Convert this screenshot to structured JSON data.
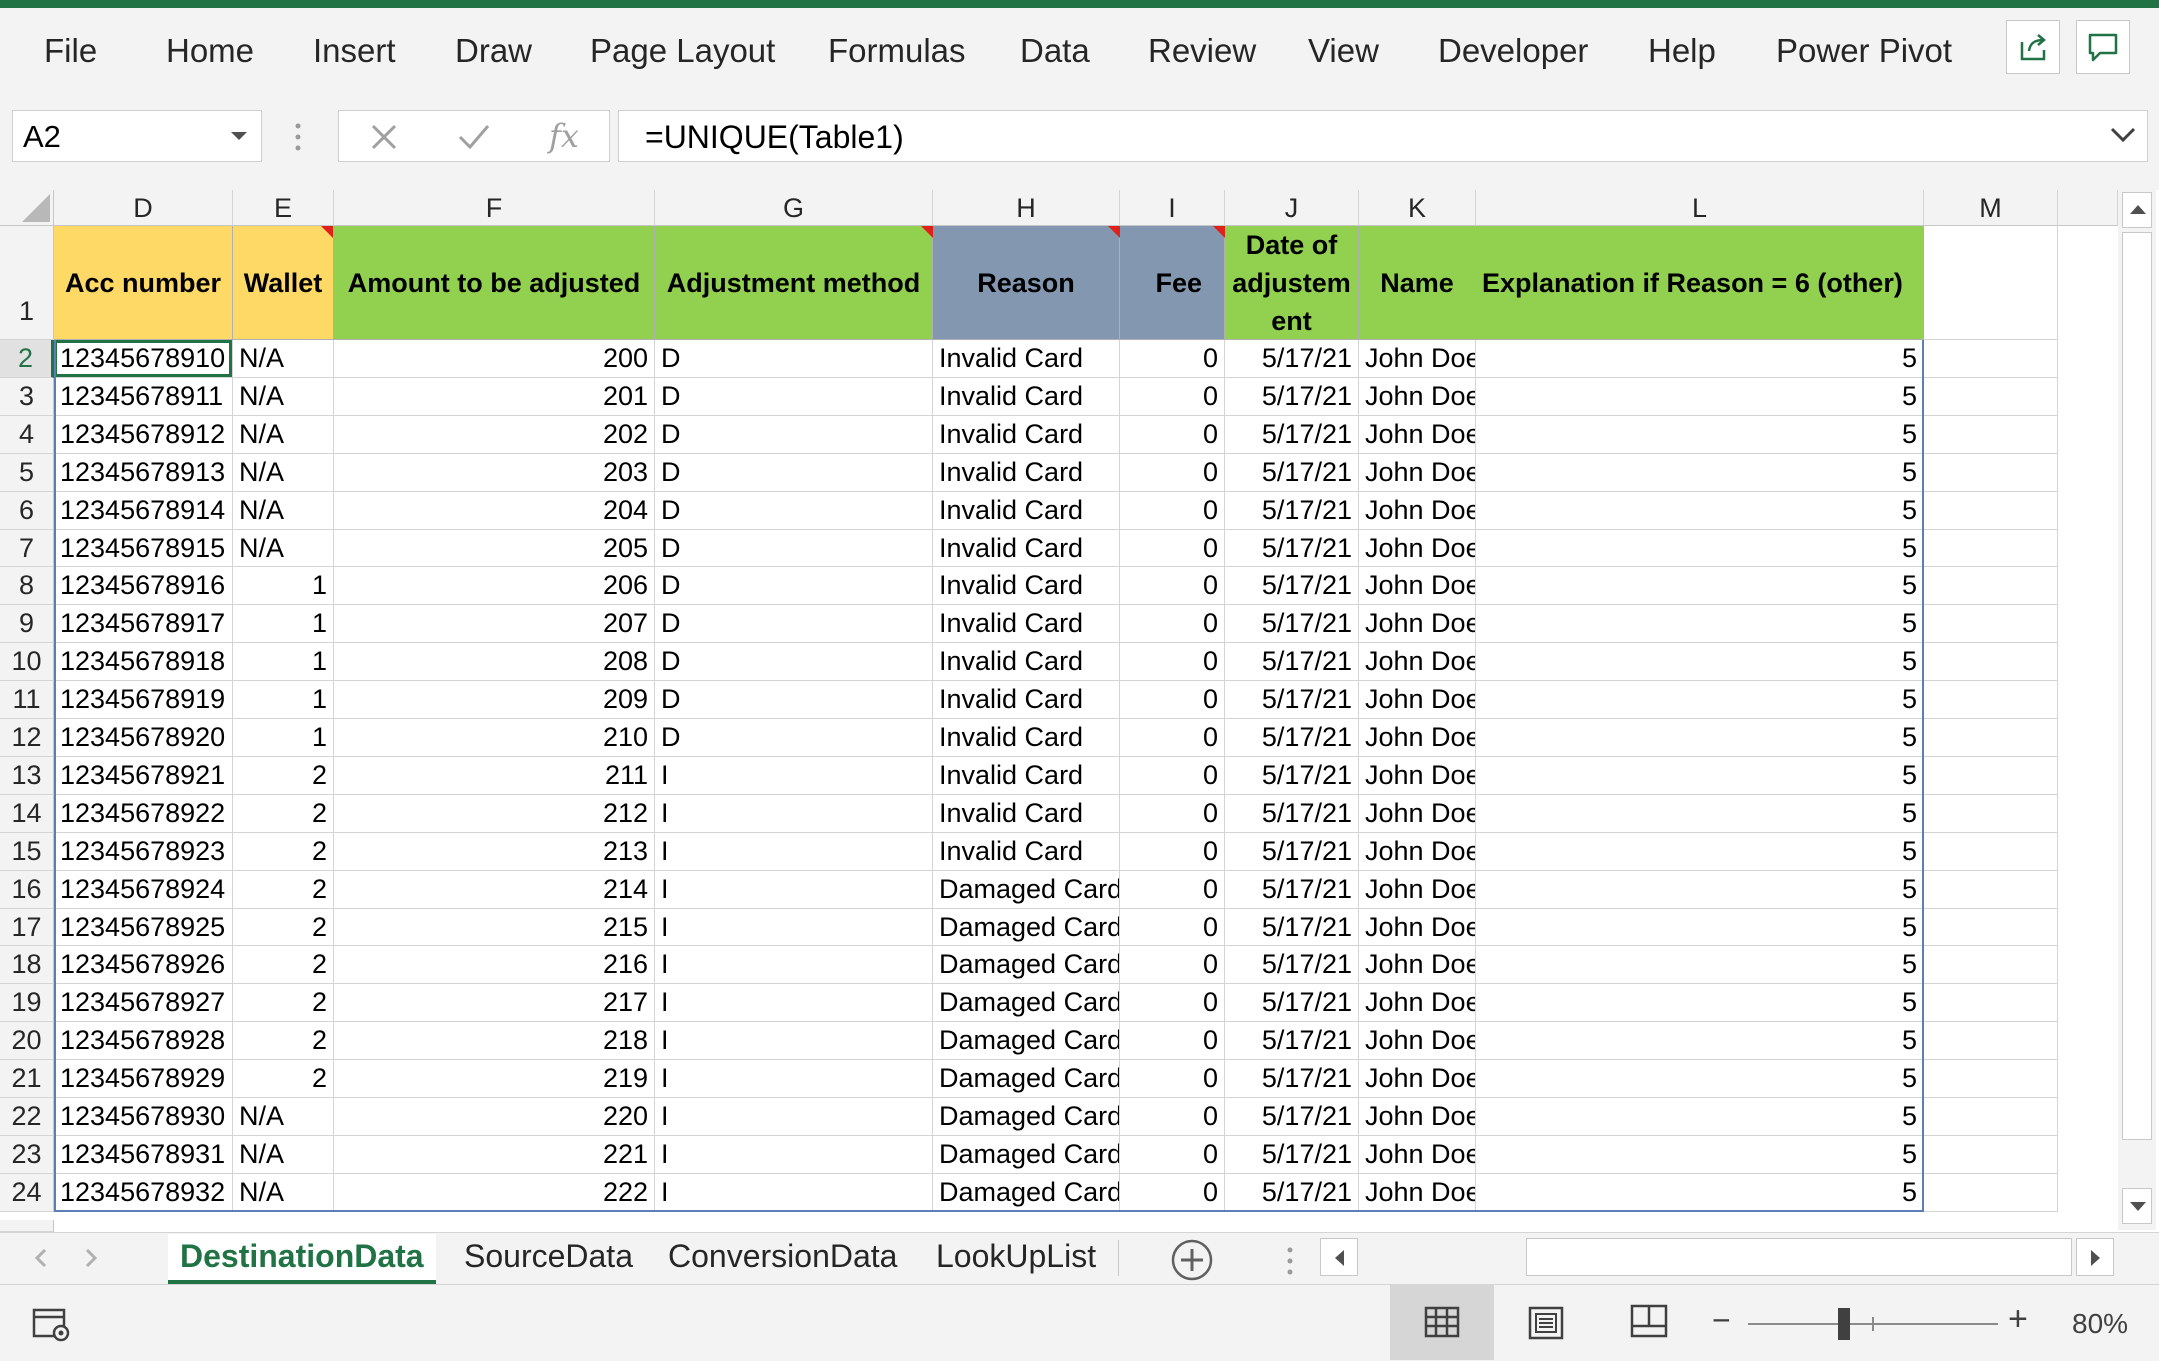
{
  "ribbon": {
    "tabs": [
      "File",
      "Home",
      "Insert",
      "Draw",
      "Page Layout",
      "Formulas",
      "Data",
      "Review",
      "View",
      "Developer",
      "Help",
      "Power Pivot"
    ],
    "share_icon": "share-icon",
    "comments_icon": "comments-icon"
  },
  "formula_bar": {
    "name_box": "A2",
    "formula": "=UNIQUE(Table1)",
    "fx_label": "fx"
  },
  "columns": [
    "D",
    "E",
    "F",
    "G",
    "H",
    "I",
    "J",
    "K",
    "L",
    "M"
  ],
  "headers": {
    "D": "Acc number",
    "E": "Wallet",
    "F": "Amount to be adjusted",
    "G": "Adjustment method",
    "H": "Reason",
    "I": "Fee",
    "J": "Date of adjustem ent",
    "K": "Name",
    "L": "Explanation if Reason = 6 (other)"
  },
  "header_row_number": "1",
  "rows": [
    {
      "n": "2",
      "acc": "12345678910",
      "wallet": "N/A",
      "amount": "200",
      "method": "D",
      "reason": "Invalid Card",
      "fee": "0",
      "date": "5/17/21",
      "name": "John Doe",
      "expl": "5"
    },
    {
      "n": "3",
      "acc": "12345678911",
      "wallet": "N/A",
      "amount": "201",
      "method": "D",
      "reason": "Invalid Card",
      "fee": "0",
      "date": "5/17/21",
      "name": "John Doe",
      "expl": "5"
    },
    {
      "n": "4",
      "acc": "12345678912",
      "wallet": "N/A",
      "amount": "202",
      "method": "D",
      "reason": "Invalid Card",
      "fee": "0",
      "date": "5/17/21",
      "name": "John Doe",
      "expl": "5"
    },
    {
      "n": "5",
      "acc": "12345678913",
      "wallet": "N/A",
      "amount": "203",
      "method": "D",
      "reason": "Invalid Card",
      "fee": "0",
      "date": "5/17/21",
      "name": "John Doe",
      "expl": "5"
    },
    {
      "n": "6",
      "acc": "12345678914",
      "wallet": "N/A",
      "amount": "204",
      "method": "D",
      "reason": "Invalid Card",
      "fee": "0",
      "date": "5/17/21",
      "name": "John Doe",
      "expl": "5"
    },
    {
      "n": "7",
      "acc": "12345678915",
      "wallet": "N/A",
      "amount": "205",
      "method": "D",
      "reason": "Invalid Card",
      "fee": "0",
      "date": "5/17/21",
      "name": "John Doe",
      "expl": "5"
    },
    {
      "n": "8",
      "acc": "12345678916",
      "wallet": "1",
      "amount": "206",
      "method": "D",
      "reason": "Invalid Card",
      "fee": "0",
      "date": "5/17/21",
      "name": "John Doe",
      "expl": "5"
    },
    {
      "n": "9",
      "acc": "12345678917",
      "wallet": "1",
      "amount": "207",
      "method": "D",
      "reason": "Invalid Card",
      "fee": "0",
      "date": "5/17/21",
      "name": "John Doe",
      "expl": "5"
    },
    {
      "n": "10",
      "acc": "12345678918",
      "wallet": "1",
      "amount": "208",
      "method": "D",
      "reason": "Invalid Card",
      "fee": "0",
      "date": "5/17/21",
      "name": "John Doe",
      "expl": "5"
    },
    {
      "n": "11",
      "acc": "12345678919",
      "wallet": "1",
      "amount": "209",
      "method": "D",
      "reason": "Invalid Card",
      "fee": "0",
      "date": "5/17/21",
      "name": "John Doe",
      "expl": "5"
    },
    {
      "n": "12",
      "acc": "12345678920",
      "wallet": "1",
      "amount": "210",
      "method": "D",
      "reason": "Invalid Card",
      "fee": "0",
      "date": "5/17/21",
      "name": "John Doe",
      "expl": "5"
    },
    {
      "n": "13",
      "acc": "12345678921",
      "wallet": "2",
      "amount": "211",
      "method": "I",
      "reason": "Invalid Card",
      "fee": "0",
      "date": "5/17/21",
      "name": "John Doe",
      "expl": "5"
    },
    {
      "n": "14",
      "acc": "12345678922",
      "wallet": "2",
      "amount": "212",
      "method": "I",
      "reason": "Invalid Card",
      "fee": "0",
      "date": "5/17/21",
      "name": "John Doe",
      "expl": "5"
    },
    {
      "n": "15",
      "acc": "12345678923",
      "wallet": "2",
      "amount": "213",
      "method": "I",
      "reason": "Invalid Card",
      "fee": "0",
      "date": "5/17/21",
      "name": "John Doe",
      "expl": "5"
    },
    {
      "n": "16",
      "acc": "12345678924",
      "wallet": "2",
      "amount": "214",
      "method": "I",
      "reason": "Damaged Card",
      "fee": "0",
      "date": "5/17/21",
      "name": "John Doe",
      "expl": "5"
    },
    {
      "n": "17",
      "acc": "12345678925",
      "wallet": "2",
      "amount": "215",
      "method": "I",
      "reason": "Damaged Card",
      "fee": "0",
      "date": "5/17/21",
      "name": "John Doe",
      "expl": "5"
    },
    {
      "n": "18",
      "acc": "12345678926",
      "wallet": "2",
      "amount": "216",
      "method": "I",
      "reason": "Damaged Card",
      "fee": "0",
      "date": "5/17/21",
      "name": "John Doe",
      "expl": "5"
    },
    {
      "n": "19",
      "acc": "12345678927",
      "wallet": "2",
      "amount": "217",
      "method": "I",
      "reason": "Damaged Card",
      "fee": "0",
      "date": "5/17/21",
      "name": "John Doe",
      "expl": "5"
    },
    {
      "n": "20",
      "acc": "12345678928",
      "wallet": "2",
      "amount": "218",
      "method": "I",
      "reason": "Damaged Card",
      "fee": "0",
      "date": "5/17/21",
      "name": "John Doe",
      "expl": "5"
    },
    {
      "n": "21",
      "acc": "12345678929",
      "wallet": "2",
      "amount": "219",
      "method": "I",
      "reason": "Damaged Card",
      "fee": "0",
      "date": "5/17/21",
      "name": "John Doe",
      "expl": "5"
    },
    {
      "n": "22",
      "acc": "12345678930",
      "wallet": "N/A",
      "amount": "220",
      "method": "I",
      "reason": "Damaged Card",
      "fee": "0",
      "date": "5/17/21",
      "name": "John Doe",
      "expl": "5"
    },
    {
      "n": "23",
      "acc": "12345678931",
      "wallet": "N/A",
      "amount": "221",
      "method": "I",
      "reason": "Damaged Card",
      "fee": "0",
      "date": "5/17/21",
      "name": "John Doe",
      "expl": "5"
    },
    {
      "n": "24",
      "acc": "12345678932",
      "wallet": "N/A",
      "amount": "222",
      "method": "I",
      "reason": "Damaged Card",
      "fee": "0",
      "date": "5/17/21",
      "name": "John Doe",
      "expl": "5"
    }
  ],
  "sheet_tabs": [
    "DestinationData",
    "SourceData",
    "ConversionData",
    "LookUpList"
  ],
  "active_sheet": "DestinationData",
  "status": {
    "zoom": "80%",
    "zoom_minus": "−",
    "zoom_plus": "+"
  },
  "colors": {
    "excel_green": "#217346",
    "header_yellow": "#FFD966",
    "header_green": "#92D050",
    "header_slate": "#8497B0",
    "comment_red": "#E0201B"
  }
}
